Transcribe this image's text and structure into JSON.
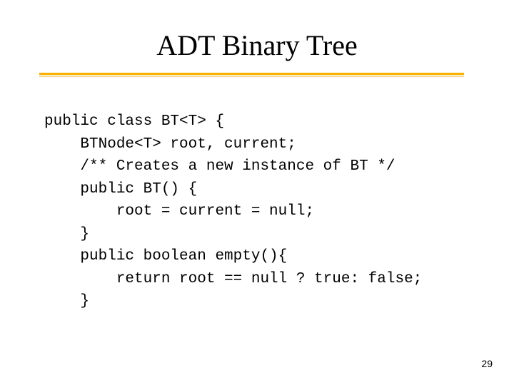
{
  "slide": {
    "title": "ADT Binary Tree",
    "page_number": "29"
  },
  "code": {
    "l1": "public class BT<T> {",
    "l2": "    BTNode<T> root, current;",
    "l3": "    /** Creates a new instance of BT */",
    "l4": "    public BT() {",
    "l5": "        root = current = null;",
    "l6": "    }",
    "l7": "    public boolean empty(){",
    "l8": "        return root == null ? true: false;",
    "l9": "    }"
  }
}
